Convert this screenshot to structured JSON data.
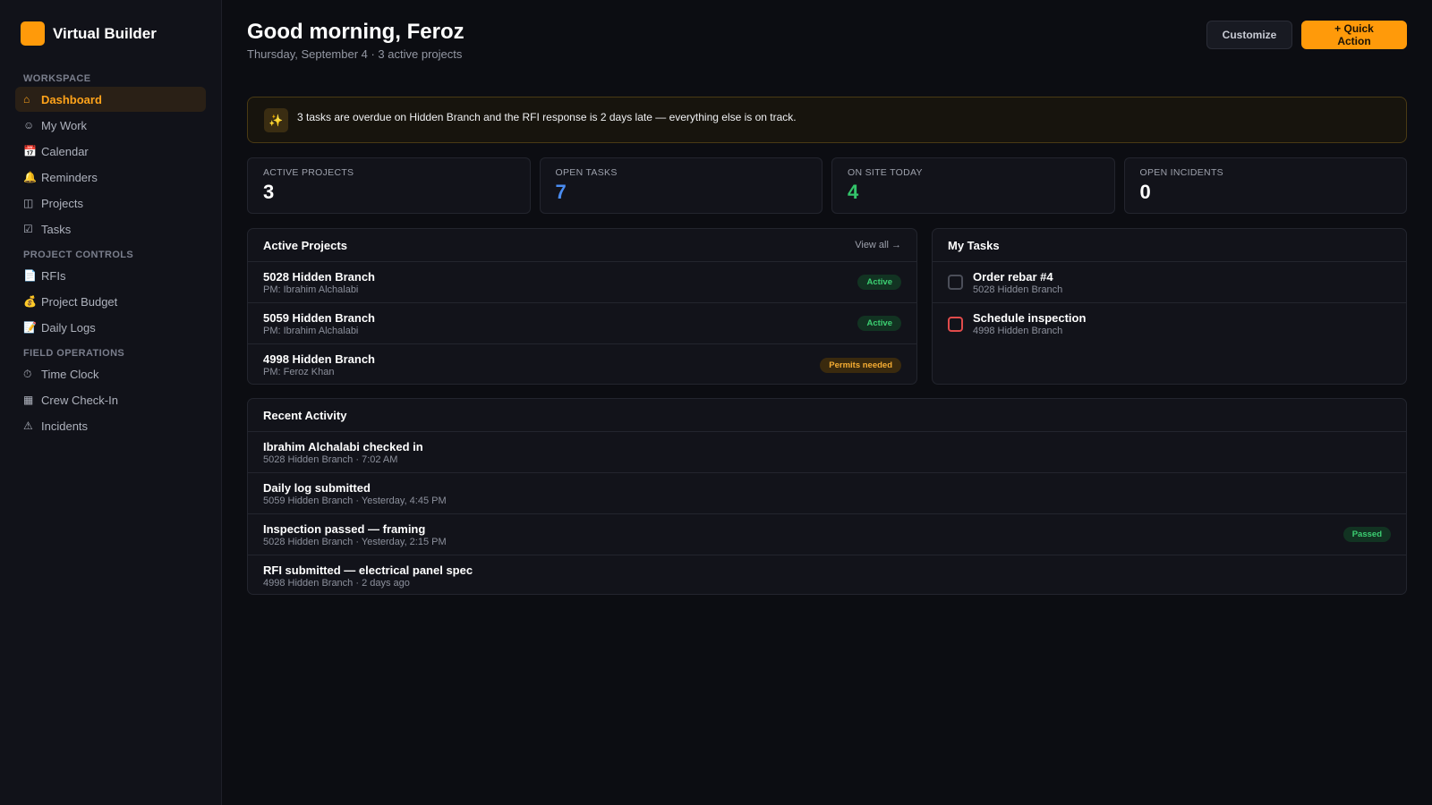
{
  "brand": {
    "name": "Virtual Builder",
    "logo_color": "#ff9a0a"
  },
  "sidebar": {
    "sections": [
      {
        "title": "WORKSPACE",
        "items": [
          {
            "icon": "⌂",
            "icon_name": "home-icon",
            "label": "Dashboard",
            "active": true
          },
          {
            "icon": "☺",
            "icon_name": "user-icon",
            "label": "My Work"
          },
          {
            "icon": "📅",
            "icon_name": "calendar-icon",
            "label": "Calendar"
          },
          {
            "icon": "🔔",
            "icon_name": "bell-icon",
            "label": "Reminders"
          },
          {
            "icon": "◫",
            "icon_name": "projects-icon",
            "label": "Projects"
          },
          {
            "icon": "☑",
            "icon_name": "checkbox-icon",
            "label": "Tasks"
          }
        ]
      },
      {
        "title": "PROJECT CONTROLS",
        "items": [
          {
            "icon": "📄",
            "icon_name": "document-icon",
            "label": "RFIs"
          },
          {
            "icon": "💰",
            "icon_name": "money-bag-icon",
            "label": "Project Budget"
          },
          {
            "icon": "📝",
            "icon_name": "memo-icon",
            "label": "Daily Logs"
          }
        ]
      },
      {
        "title": "FIELD OPERATIONS",
        "items": [
          {
            "icon": "⏱",
            "icon_name": "stopwatch-icon",
            "label": "Time Clock"
          },
          {
            "icon": "▦",
            "icon_name": "grid-icon",
            "label": "Crew Check-In"
          },
          {
            "icon": "⚠",
            "icon_name": "warning-icon",
            "label": "Incidents"
          }
        ]
      }
    ]
  },
  "header": {
    "greeting": "Good morning, Feroz",
    "subtitle": "Thursday, September 4 · 3 active projects",
    "customize_label": "Customize",
    "quick_action_label": "+ Quick Action"
  },
  "alert": {
    "icon": "✨",
    "text": "3 tasks are overdue on Hidden Branch and the RFI response is 2 days late — everything else is on track."
  },
  "stats": [
    {
      "label": "ACTIVE PROJECTS",
      "value": "3",
      "color": "#ffffff"
    },
    {
      "label": "OPEN TASKS",
      "value": "7",
      "color": "#4a8cf0"
    },
    {
      "label": "ON SITE TODAY",
      "value": "4",
      "color": "#33c46a"
    },
    {
      "label": "OPEN INCIDENTS",
      "value": "0",
      "color": "#ffffff"
    }
  ],
  "active_projects": {
    "title": "Active Projects",
    "view_all": "View all →",
    "items": [
      {
        "name": "5028 Hidden Branch",
        "pm": "PM: Ibrahim Alchalabi",
        "status": "Active",
        "status_type": "green"
      },
      {
        "name": "5059 Hidden Branch",
        "pm": "PM: Ibrahim Alchalabi",
        "status": "Active",
        "status_type": "green"
      },
      {
        "name": "4998 Hidden Branch",
        "pm": "PM: Feroz Khan",
        "status": "Permits needed",
        "status_type": "amber"
      }
    ]
  },
  "my_tasks": {
    "title": "My Tasks",
    "items": [
      {
        "name": "Order rebar #4",
        "project": "5028 Hidden Branch",
        "overdue": false
      },
      {
        "name": "Schedule inspection",
        "project": "4998 Hidden Branch",
        "overdue": true
      }
    ]
  },
  "recent_activity": {
    "title": "Recent Activity",
    "items": [
      {
        "title": "Ibrahim Alchalabi checked in",
        "meta": "5028 Hidden Branch · 7:02 AM",
        "badge": ""
      },
      {
        "title": "Daily log submitted",
        "meta": "5059 Hidden Branch · Yesterday, 4:45 PM",
        "badge": ""
      },
      {
        "title": "Inspection passed — framing",
        "meta": "5028 Hidden Branch · Yesterday, 2:15 PM",
        "badge": "Passed"
      },
      {
        "title": "RFI submitted — electrical panel spec",
        "meta": "4998 Hidden Branch · 2 days ago",
        "badge": ""
      }
    ]
  }
}
